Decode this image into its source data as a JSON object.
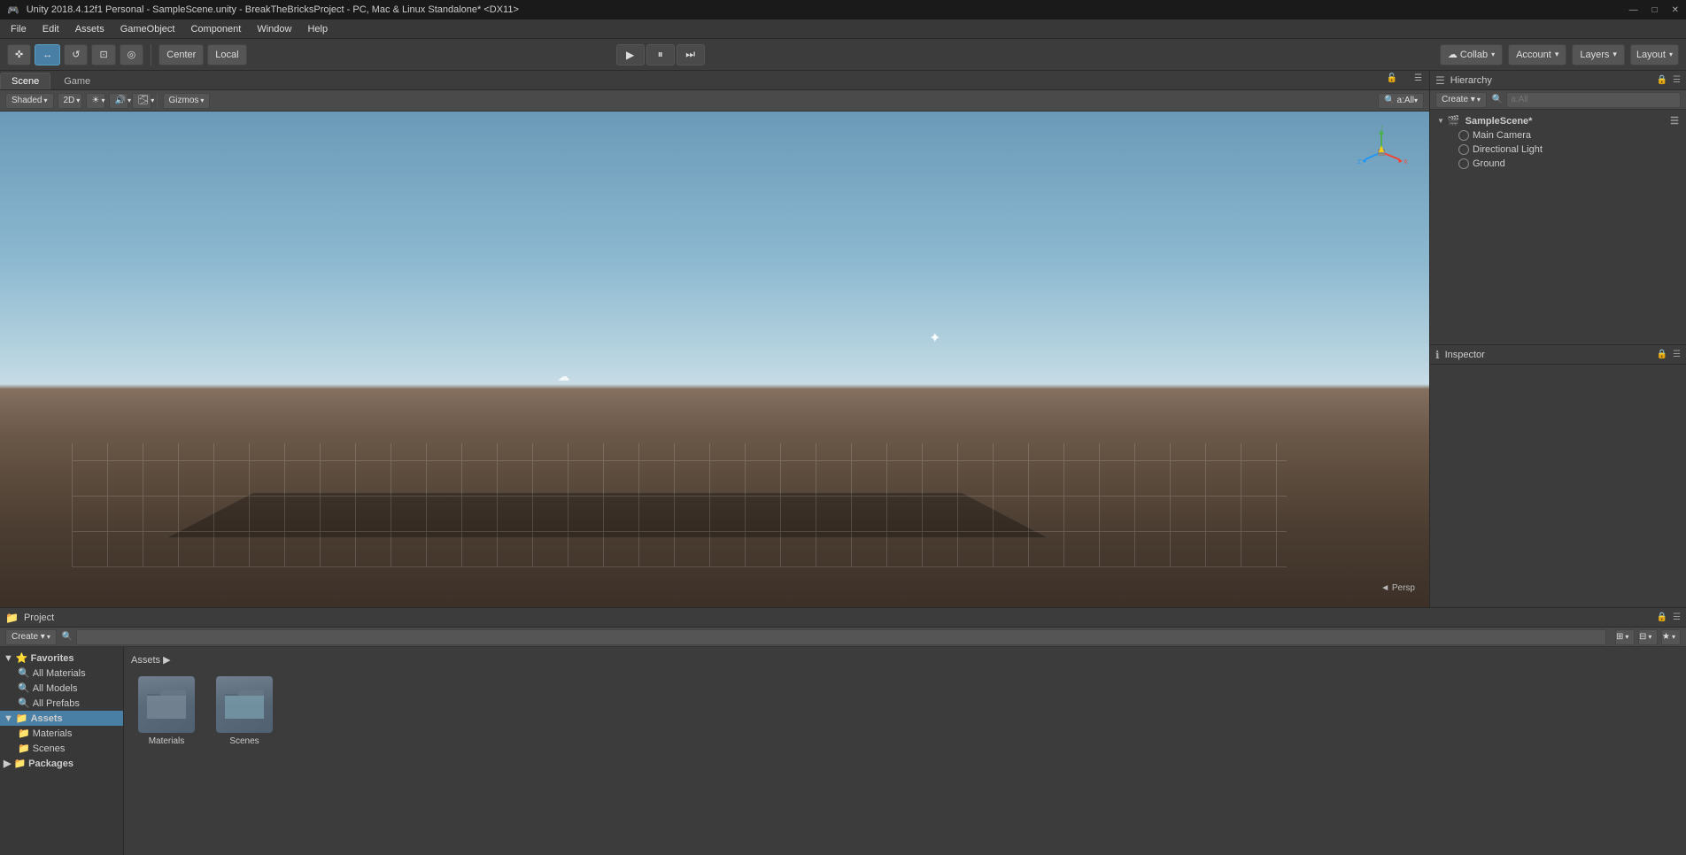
{
  "titlebar": {
    "title": "Unity 2018.4.12f1 Personal - SampleScene.unity - BreakTheBricksProject - PC, Mac & Linux Standalone* <DX11>",
    "minimize": "—",
    "maximize": "□",
    "close": "✕"
  },
  "menubar": {
    "items": [
      "File",
      "Edit",
      "Assets",
      "GameObject",
      "Component",
      "Window",
      "Help"
    ]
  },
  "toolbar": {
    "tools": [
      "✜",
      "↔",
      "↺",
      "⊡",
      "◎"
    ],
    "center_btn": "Center",
    "local_btn": "Local",
    "collab": "Collab",
    "account": "Account",
    "layers": "Layers",
    "layout": "Layout"
  },
  "scene_view": {
    "tabs": [
      "Scene",
      "Game"
    ],
    "shading_mode": "Shaded",
    "is_2d": "2D",
    "gizmos_btn": "Gizmos",
    "search_placeholder": "a:All",
    "persp_label": "◄ Persp"
  },
  "hierarchy": {
    "panel_title": "Hierarchy",
    "create_btn": "Create ▾",
    "search_placeholder": "a:All",
    "scene_name": "SampleScene*",
    "items": [
      {
        "name": "Main Camera",
        "type": "camera"
      },
      {
        "name": "Directional Light",
        "type": "light"
      },
      {
        "name": "Ground",
        "type": "mesh"
      }
    ]
  },
  "inspector": {
    "panel_title": "Inspector",
    "tab_label": "Inspector"
  },
  "project": {
    "panel_title": "Project",
    "create_btn": "Create ▾",
    "search_placeholder": "",
    "tree": {
      "favorites": {
        "label": "Favorites",
        "items": [
          "All Materials",
          "All Models",
          "All Prefabs"
        ]
      },
      "assets": {
        "label": "Assets",
        "items": [
          "Materials",
          "Scenes"
        ]
      },
      "packages": {
        "label": "Packages"
      }
    },
    "assets_header": "Assets ▶",
    "asset_folders": [
      {
        "name": "Materials",
        "type": "folder"
      },
      {
        "name": "Scenes",
        "type": "folder"
      }
    ]
  }
}
